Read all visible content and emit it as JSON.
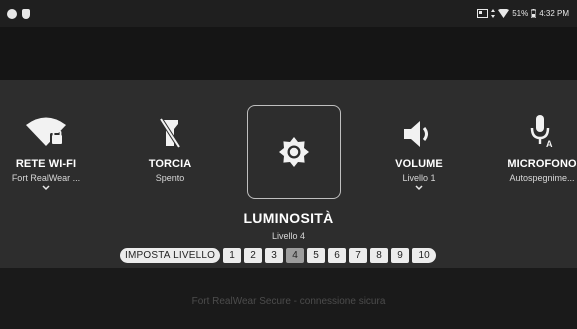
{
  "status_bar": {
    "battery_percent": "51%",
    "time": "4:32 PM"
  },
  "background": {
    "footer_text": "Fort RealWear Secure - connessione sicura"
  },
  "tiles": [
    {
      "label": "RETE WI-FI",
      "sub": "Fort RealWear ...",
      "icon": "wifi-lock-icon",
      "has_chevron": true
    },
    {
      "label": "TORCIA",
      "sub": "Spento",
      "icon": "flashlight-off-icon",
      "has_chevron": false
    },
    {
      "label": "VOLUME",
      "sub": "Livello 1",
      "icon": "volume-icon",
      "has_chevron": true
    },
    {
      "label": "MICROFONO",
      "sub": "Autospegnime...",
      "icon": "microphone-auto-icon",
      "has_chevron": false
    }
  ],
  "brightness": {
    "title": "LUMINOSITÀ",
    "sub": "Livello 4",
    "icon": "brightness-icon",
    "set_level_label": "IMPOSTA LIVELLO",
    "levels": [
      "1",
      "2",
      "3",
      "4",
      "5",
      "6",
      "7",
      "8",
      "9",
      "10"
    ],
    "selected_level": "4"
  },
  "colors": {
    "panel": "#2d2d2d",
    "chip": "#ececec",
    "chip_selected": "#9d9d9d"
  }
}
